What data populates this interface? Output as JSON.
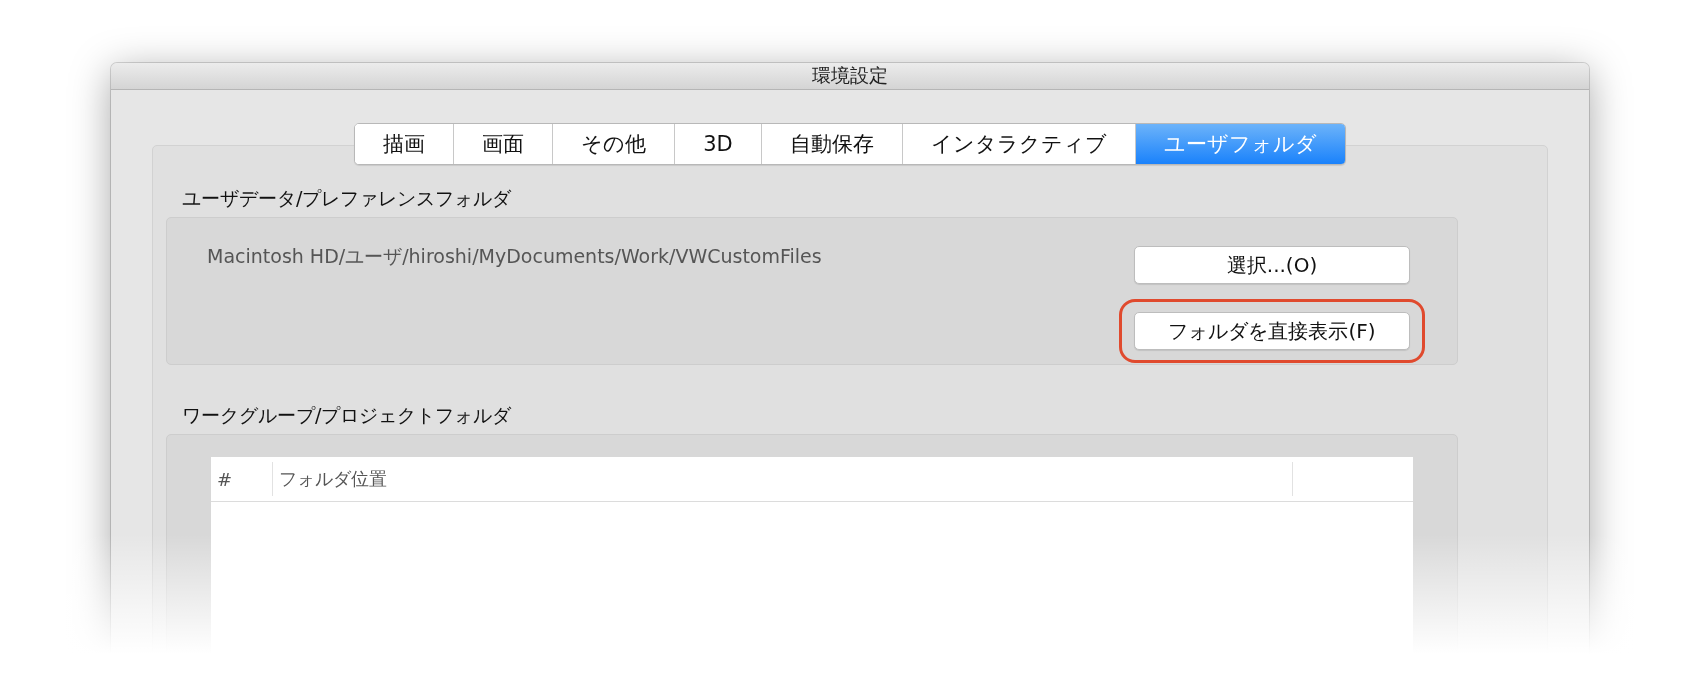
{
  "window": {
    "title": "環境設定"
  },
  "tabs": [
    {
      "label": "描画",
      "selected": false
    },
    {
      "label": "画面",
      "selected": false
    },
    {
      "label": "その他",
      "selected": false
    },
    {
      "label": "3D",
      "selected": false
    },
    {
      "label": "自動保存",
      "selected": false
    },
    {
      "label": "インタラクティブ",
      "selected": false
    },
    {
      "label": "ユーザフォルダ",
      "selected": true
    }
  ],
  "user_folder": {
    "label": "ユーザデータ/プレファレンスフォルダ",
    "path": "Macintosh HD/ユーザ/hiroshi/MyDocuments/Work/VWCustomFiles",
    "buttons": [
      {
        "label": "選択...(O)",
        "highlighted": false
      },
      {
        "label": "フォルダを直接表示(F)",
        "highlighted": true
      }
    ]
  },
  "workgroup_folder": {
    "label": "ワークグループ/プロジェクトフォルダ",
    "table": {
      "columns": [
        "#",
        "フォルダ位置"
      ]
    }
  }
}
